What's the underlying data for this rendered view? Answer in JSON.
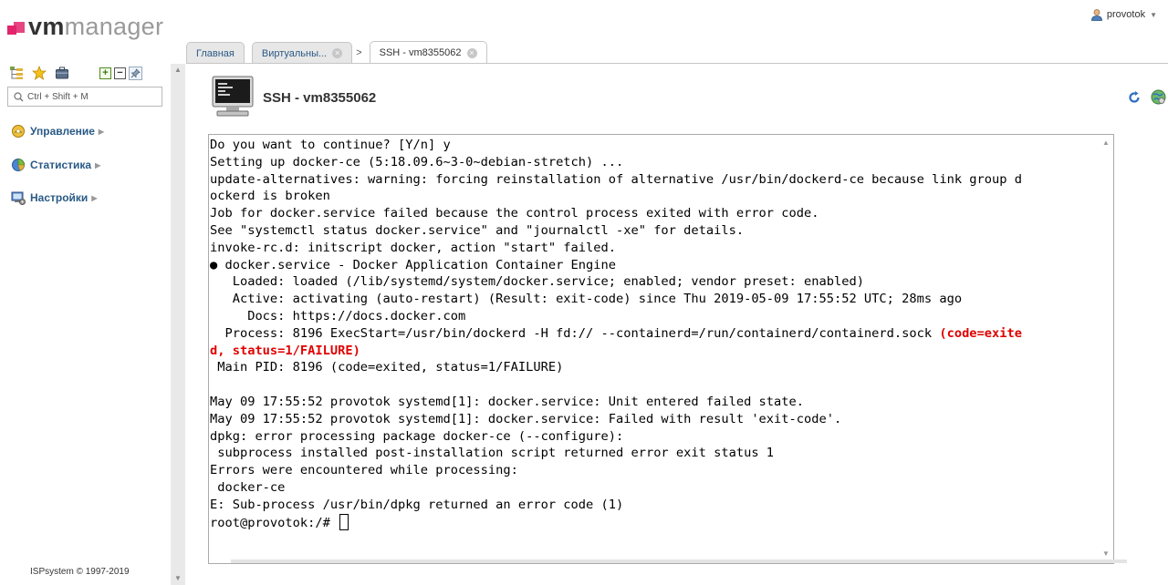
{
  "brand": {
    "vm": "vm",
    "rest": "manager"
  },
  "user": {
    "name": "provotok"
  },
  "sidebar": {
    "search_placeholder": "Ctrl + Shift + M",
    "items": [
      {
        "label": "Управление"
      },
      {
        "label": "Статистика"
      },
      {
        "label": "Настройки"
      }
    ],
    "copyright": "ISPsystem © 1997-2019"
  },
  "tabs": [
    {
      "label": "Главная"
    },
    {
      "label": "Виртуальны..."
    },
    {
      "label": "SSH - vm8355062"
    }
  ],
  "page": {
    "title": "SSH - vm8355062"
  },
  "terminal": {
    "lines": [
      "Do you want to continue? [Y/n] y",
      "Setting up docker-ce (5:18.09.6~3-0~debian-stretch) ...",
      "update-alternatives: warning: forcing reinstallation of alternative /usr/bin/dockerd-ce because link group d",
      "ockerd is broken",
      "Job for docker.service failed because the control process exited with error code.",
      "See \"systemctl status docker.service\" and \"journalctl -xe\" for details.",
      "invoke-rc.d: initscript docker, action \"start\" failed.",
      "● docker.service - Docker Application Container Engine",
      "   Loaded: loaded (/lib/systemd/system/docker.service; enabled; vendor preset: enabled)",
      "   Active: activating (auto-restart) (Result: exit-code) since Thu 2019-05-09 17:55:52 UTC; 28ms ago",
      "     Docs: https://docs.docker.com",
      "  Process: 8196 ExecStart=/usr/bin/dockerd -H fd:// --containerd=/run/containerd/containerd.sock "
    ],
    "error_part1": "(code=exite",
    "error_part2": "d, status=1/FAILURE)",
    "lines_after": [
      " Main PID: 8196 (code=exited, status=1/FAILURE)",
      "",
      "May 09 17:55:52 provotok systemd[1]: docker.service: Unit entered failed state.",
      "May 09 17:55:52 provotok systemd[1]: docker.service: Failed with result 'exit-code'.",
      "dpkg: error processing package docker-ce (--configure):",
      " subprocess installed post-installation script returned error exit status 1",
      "Errors were encountered while processing:",
      " docker-ce",
      "E: Sub-process /usr/bin/dpkg returned an error code (1)"
    ],
    "prompt": "root@provotok:/# ",
    "error_color": "#e00000"
  }
}
